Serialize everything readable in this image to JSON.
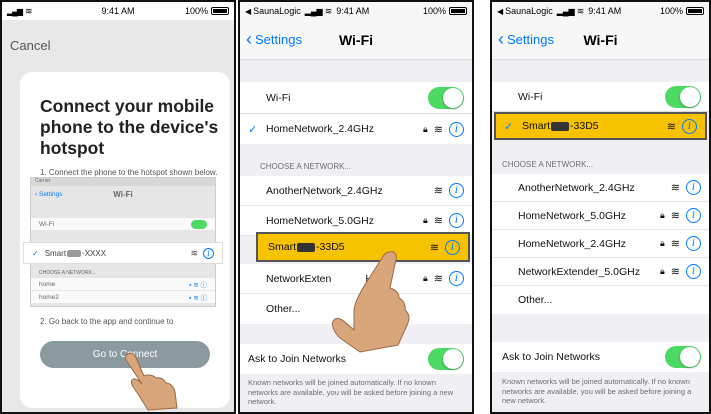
{
  "p1": {
    "status_time": "9:41 AM",
    "status_batt": "100%",
    "cancel": "Cancel",
    "heading": "Connect your mobile phone to the device's hotspot",
    "step1": "1. Connect the phone to the hotspot shown below.",
    "step2": "2. Go back to the app and continue to",
    "button": "Go to Connect",
    "mini": {
      "carrier": "Carrier",
      "back": "Settings",
      "title": "Wi-Fi",
      "wifi_label": "Wi-Fi",
      "selected_prefix": "Smart",
      "selected_suffix": "-XXXX",
      "header": "CHOOSE A NETWORK...",
      "net1": "home",
      "net2": "home2"
    }
  },
  "p2": {
    "app": "SaunaLogic",
    "status_time": "9:41 AM",
    "status_batt": "100%",
    "back": "Settings",
    "title": "Wi-Fi",
    "wifi_label": "Wi-Fi",
    "connected": "HomeNetwork_2.4GHz",
    "header": "CHOOSE A NETWORK...",
    "networks": [
      "AnotherNetwork_2.4GHz",
      "HomeNetwork_5.0GHz",
      "Smart",
      "NetworkExten"
    ],
    "smart_suffix": "-33D5",
    "ext_suffix": "Hz",
    "other": "Other...",
    "ask": "Ask to Join Networks",
    "note": "Known networks will be joined automatically. If no known networks are available, you will be asked before joining a new network."
  },
  "p3": {
    "app": "SaunaLogic",
    "status_time": "9:41 AM",
    "status_batt": "100%",
    "back": "Settings",
    "title": "Wi-Fi",
    "wifi_label": "Wi-Fi",
    "connected_prefix": "Smart",
    "connected_suffix": "-33D5",
    "header": "CHOOSE A NETWORK...",
    "networks": [
      "AnotherNetwork_2.4GHz",
      "HomeNetwork_5.0GHz",
      "HomeNetwork_2.4GHz",
      "NetworkExtender_5.0GHz"
    ],
    "other": "Other...",
    "ask": "Ask to Join Networks",
    "note": "Known networks will be joined automatically. If no known networks are available, you will be asked before joining a new network."
  },
  "icons": {
    "signal": "signal-icon",
    "wifi": "wifi-icon",
    "battery": "battery-icon",
    "lock": "lock-icon",
    "info": "info-icon",
    "check": "checkmark-icon",
    "chevron": "chevron-left-icon",
    "hand": "pointing-hand-icon"
  },
  "colors": {
    "accent": "#007aff",
    "toggle_on": "#4cd964",
    "highlight": "#f7c200",
    "button": "#8a9a9e"
  }
}
